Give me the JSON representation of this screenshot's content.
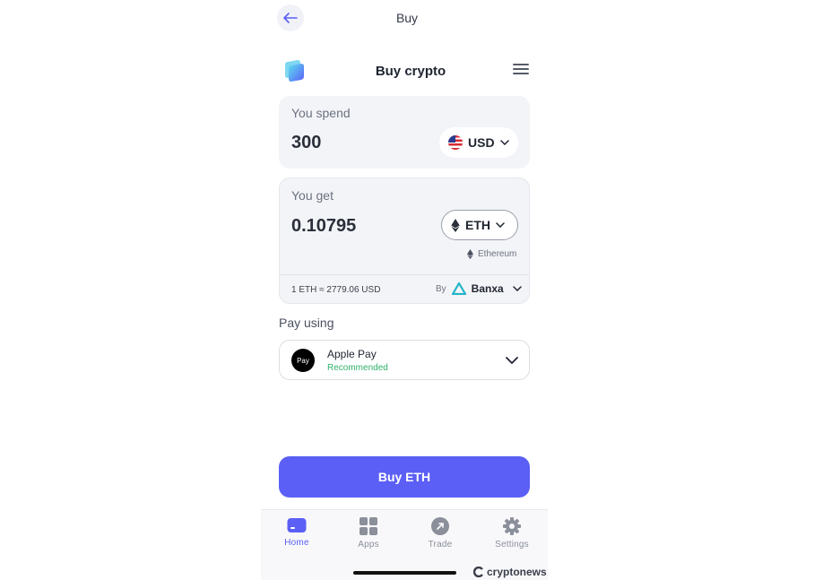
{
  "top_bar": {
    "title": "Buy"
  },
  "header": {
    "title": "Buy crypto"
  },
  "spend": {
    "label": "You spend",
    "amount": "300",
    "currency": "USD"
  },
  "get": {
    "label": "You get",
    "amount": "0.10795",
    "currency": "ETH",
    "network": "Ethereum",
    "rate": "1 ETH ≈ 2779.06 USD",
    "by_label": "By",
    "provider": "Banxa"
  },
  "pay": {
    "label": "Pay using",
    "method": "Apple Pay",
    "method_logo_text": "Pay",
    "note": "Recommended"
  },
  "buy_button": {
    "label": "Buy ETH"
  },
  "nav": {
    "items": [
      {
        "label": "Home",
        "icon": "card-icon",
        "active": true
      },
      {
        "label": "Apps",
        "icon": "grid-icon",
        "active": false
      },
      {
        "label": "Trade",
        "icon": "swap-icon",
        "active": false
      },
      {
        "label": "Settings",
        "icon": "gear-icon",
        "active": false
      }
    ]
  },
  "watermark": {
    "text": "cryptonews"
  },
  "colors": {
    "accent": "#5b5ff5",
    "success": "#2fb36b",
    "card_bg": "#f3f4f7"
  }
}
